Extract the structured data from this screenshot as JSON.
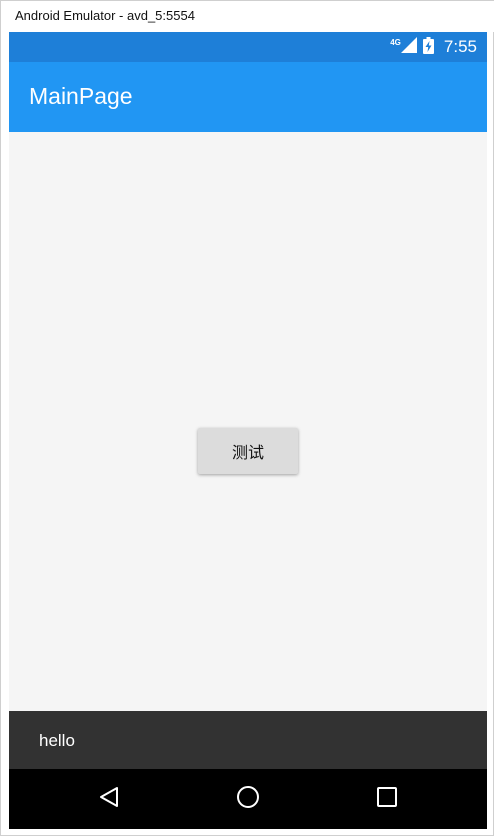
{
  "window": {
    "title": "Android Emulator - avd_5:5554"
  },
  "status_bar": {
    "network": "4G",
    "time": "7:55",
    "icons": [
      "signal-icon",
      "battery-charging-icon"
    ]
  },
  "app_bar": {
    "title": "MainPage"
  },
  "main": {
    "button_label": "测试"
  },
  "toast": {
    "message": "hello"
  },
  "nav_bar": {
    "buttons": [
      "back-icon",
      "home-icon",
      "recents-icon"
    ]
  },
  "colors": {
    "status_bar": "#1e7fd8",
    "app_bar": "#2196f3",
    "content_bg": "#f5f5f5",
    "button_bg": "#dcdcdc",
    "toast_bg": "#323232",
    "nav_bar": "#000000"
  }
}
